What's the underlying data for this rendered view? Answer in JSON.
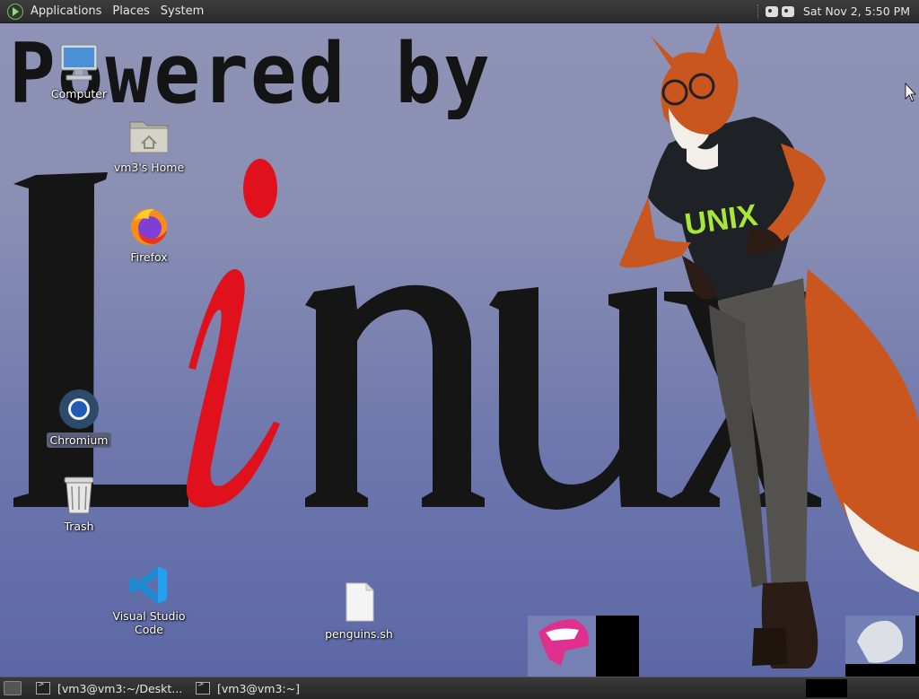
{
  "top_panel": {
    "menus": [
      "Applications",
      "Places",
      "System"
    ],
    "clock": "Sat Nov 2, 5:50 PM",
    "tray_icons": [
      "network-icon",
      "volume-icon"
    ]
  },
  "wallpaper": {
    "line1": "Powered by",
    "line2": "Linux",
    "shirt_text": "UNIX",
    "colors": {
      "red_i": "#e0101c",
      "text": "#141414",
      "fox_orange": "#c9551f",
      "shirt": "#1e2226",
      "shirt_text": "#a8e63a"
    }
  },
  "desktop_icons": [
    {
      "id": "computer",
      "label": "Computer",
      "icon": "computer-icon"
    },
    {
      "id": "home",
      "label": "vm3's Home",
      "icon": "home-folder-icon"
    },
    {
      "id": "firefox",
      "label": "Firefox",
      "icon": "firefox-icon"
    },
    {
      "id": "chromium",
      "label": "Chromium",
      "icon": "chromium-icon",
      "selected": true
    },
    {
      "id": "trash",
      "label": "Trash",
      "icon": "trash-icon"
    },
    {
      "id": "vscode",
      "label": "Visual Studio Code",
      "icon": "vscode-icon"
    },
    {
      "id": "penguins",
      "label": "penguins.sh",
      "icon": "script-file-icon"
    }
  ],
  "bottom_panel": {
    "tasks": [
      {
        "label": "[vm3@vm3:~/Deskt...",
        "icon": "terminal-icon"
      },
      {
        "label": "[vm3@vm3:~]",
        "icon": "terminal-icon"
      }
    ]
  }
}
